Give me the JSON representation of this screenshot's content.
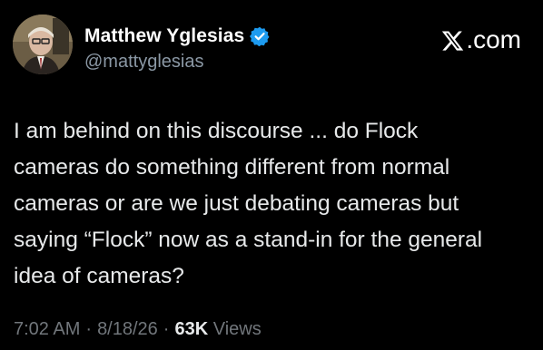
{
  "author": {
    "display_name": "Matthew Yglesias",
    "handle": "@mattyglesias",
    "verified": true
  },
  "brand": {
    "label": ".com",
    "icon": "x-logo-icon"
  },
  "tweet": {
    "lines": [
      "I am behind on this discourse ... do Flock",
      "cameras do something different from normal",
      "cameras or are we just debating cameras but",
      "saying “Flock” now as a stand-in for the general",
      "idea of cameras?"
    ]
  },
  "meta": {
    "time": "7:02 AM",
    "date": "8/18/26",
    "views_count": "63K",
    "views_label": "Views",
    "separator": "·"
  },
  "colors": {
    "background": "#000000",
    "text": "#e7e9ea",
    "secondary": "#71767b",
    "verified_blue": "#1d9bf0"
  }
}
